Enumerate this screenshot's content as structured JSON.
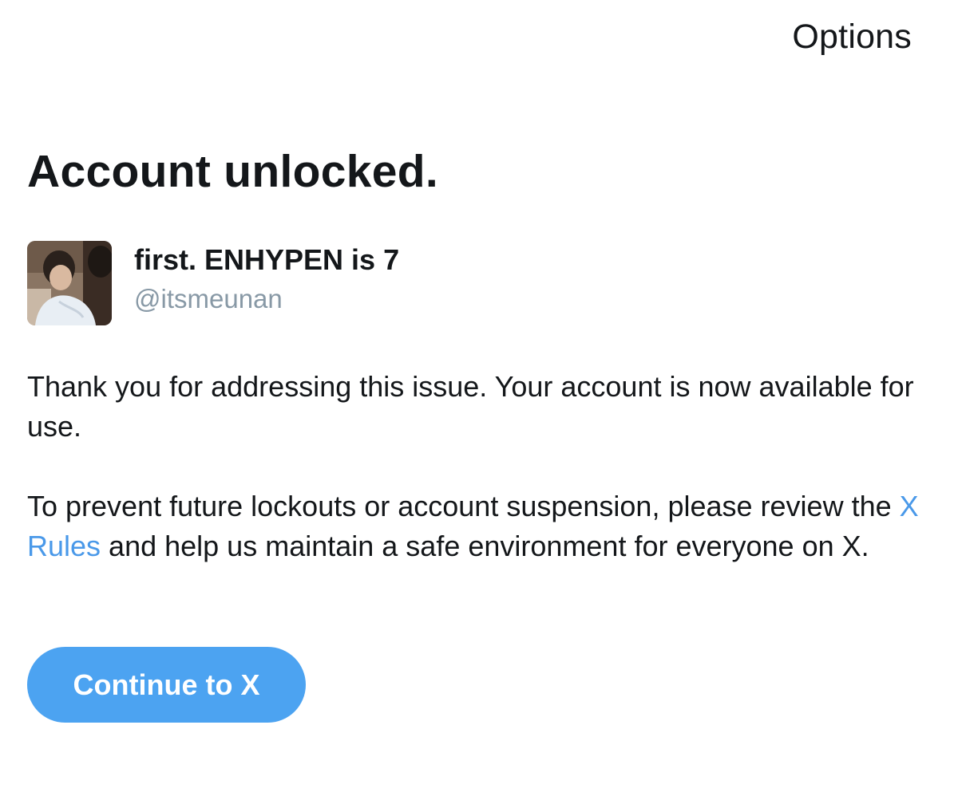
{
  "header": {
    "options_label": "Options"
  },
  "title": "Account unlocked.",
  "profile": {
    "display_name": "first. ENHYPEN is 7",
    "handle": "@itsmeunan"
  },
  "message": {
    "paragraph1": "Thank you for addressing this issue. Your account is now available for use.",
    "paragraph2_before": "To prevent future lockouts or account suspension, please review the ",
    "rules_link": "X Rules",
    "paragraph2_after": " and help us maintain a safe environment for everyone on X."
  },
  "continue_button": {
    "label": "Continue to X"
  },
  "colors": {
    "link": "#4a99e9",
    "button_bg": "#4ca3f1",
    "handle": "#8899a6",
    "text": "#14171a"
  }
}
